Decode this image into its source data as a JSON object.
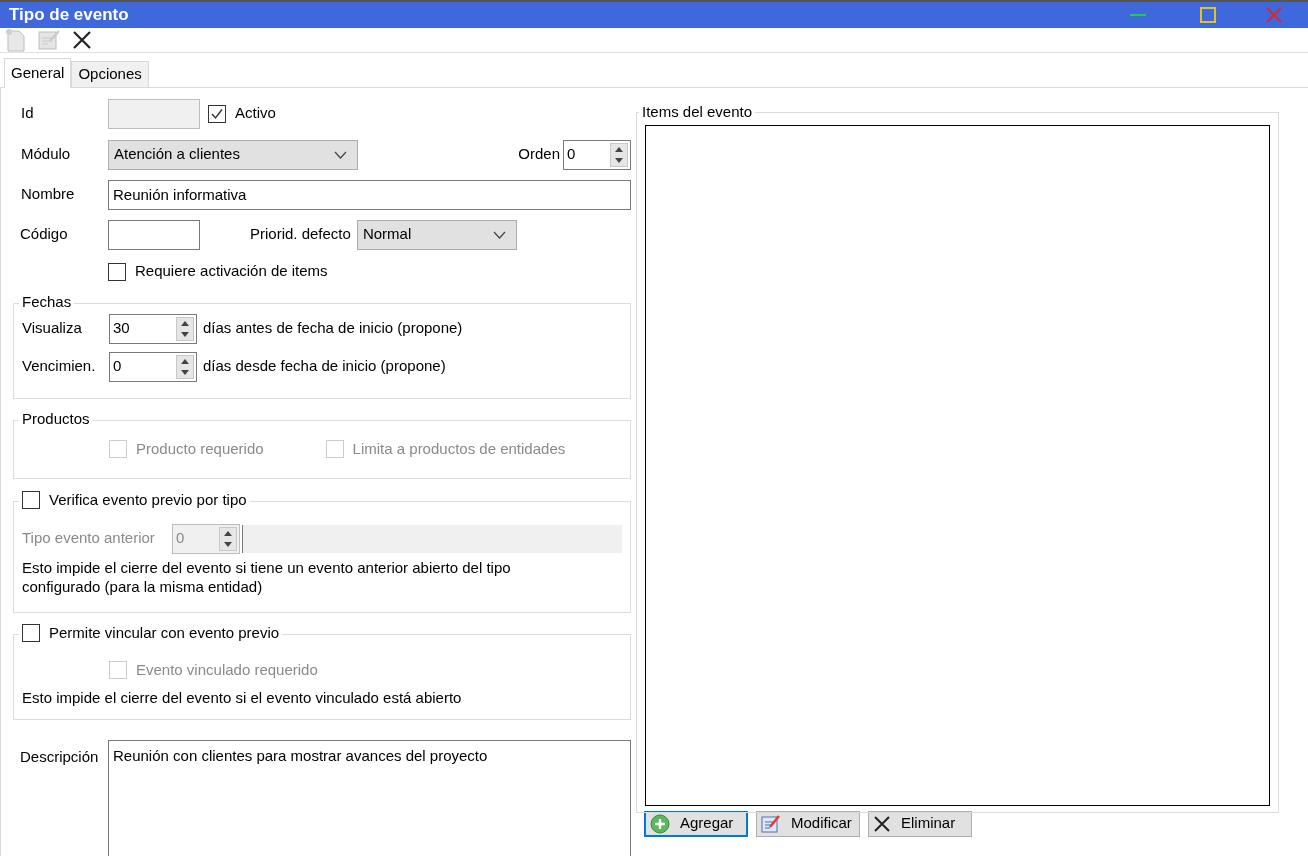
{
  "window": {
    "title": "Tipo de evento"
  },
  "tabs": [
    {
      "label": "General",
      "selected": true
    },
    {
      "label": "Opciones",
      "selected": false
    }
  ],
  "general": {
    "id": {
      "label": "Id"
    },
    "activo": {
      "label": "Activo",
      "checked": true
    },
    "modulo": {
      "label": "Módulo",
      "value": "Atención a clientes"
    },
    "orden": {
      "label": "Orden",
      "value": "0"
    },
    "nombre": {
      "label": "Nombre",
      "value": "Reunión informativa"
    },
    "codigo": {
      "label": "Código"
    },
    "prioridad": {
      "label": "Priorid. defecto",
      "value": "Normal"
    },
    "requiere": {
      "label": "Requiere activación de items",
      "checked": false
    },
    "fechas": {
      "title": "Fechas",
      "rows": [
        {
          "label": "Visualiza",
          "value": "30",
          "suffix": "días antes de fecha de inicio (propone)"
        },
        {
          "label": "Vencimien.",
          "value": "0",
          "suffix": "días desde fecha de inicio (propone)"
        }
      ]
    },
    "productos": {
      "title": "Productos",
      "options": [
        {
          "label": "Producto requerido",
          "checked": false,
          "disabled": true
        },
        {
          "label": "Limita a productos de entidades",
          "checked": false,
          "disabled": true
        }
      ]
    },
    "verifica": {
      "label": "Verifica evento previo por tipo",
      "checked": false,
      "tipo_label": "Tipo evento anterior",
      "tipo_value": "0",
      "disabled": true,
      "note": "Esto impide el cierre del evento si tiene un evento anterior abierto del tipo configurado (para la misma entidad)"
    },
    "permite": {
      "label": "Permite vincular con evento previo",
      "checked": false,
      "option": {
        "label": "Evento vinculado requerido",
        "checked": false,
        "disabled": true
      },
      "note": "Esto impide el cierre del evento si el evento vinculado está abierto"
    },
    "descripcion": {
      "label": "Descripción",
      "value": "Reunión con clientes para mostrar avances del proyecto"
    }
  },
  "items": {
    "title": "Items del evento",
    "buttons": [
      {
        "label": "Agregar",
        "kind": "add",
        "focused": true
      },
      {
        "label": "Modificar",
        "kind": "edit",
        "focused": false
      },
      {
        "label": "Eliminar",
        "kind": "delete",
        "focused": false
      }
    ]
  }
}
